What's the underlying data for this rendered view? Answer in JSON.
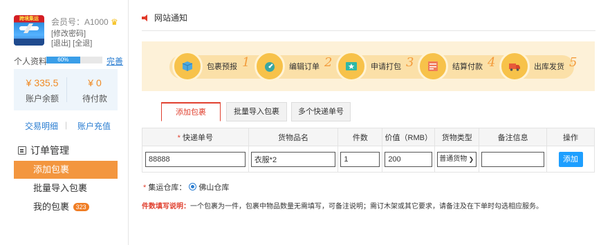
{
  "sidebar": {
    "avatar_logo_text": "跨境集运",
    "member_label": "会员号：A1000",
    "links_line1": "[修改密码]",
    "links_line2": "[退出] [全退]",
    "profile_label": "个人资料",
    "profile_progress": 0.6,
    "profile_progress_text": "60%",
    "profile_complete_link": "完善",
    "balance_value": "¥ 335.5",
    "balance_label": "账户余额",
    "pending_value": "¥ 0",
    "pending_label": "待付款",
    "transactions_link": "交易明细",
    "recharge_link": "账户充值",
    "menu_section": "订单管理",
    "menu_items": [
      {
        "label": "添加包裹",
        "active": true
      },
      {
        "label": "批量导入包裹",
        "active": false
      },
      {
        "label": "我的包裹",
        "active": false,
        "badge": "323"
      }
    ]
  },
  "notice": {
    "title": "网站通知"
  },
  "steps": [
    {
      "label": "包裹预报",
      "num": "1",
      "icon": "box-icon"
    },
    {
      "label": "编辑订单",
      "num": "2",
      "icon": "gauge-icon"
    },
    {
      "label": "申请打包",
      "num": "3",
      "icon": "star-package-icon"
    },
    {
      "label": "结算付款",
      "num": "4",
      "icon": "payment-icon"
    },
    {
      "label": "出库发货",
      "num": "5",
      "icon": "truck-icon"
    }
  ],
  "tabs": [
    {
      "label": "添加包裹",
      "active": true
    },
    {
      "label": "批量导入包裹",
      "active": false
    },
    {
      "label": "多个快递单号",
      "active": false
    }
  ],
  "table": {
    "headers": [
      "快递单号",
      "货物品名",
      "件数",
      "价值（RMB）",
      "货物类型",
      "备注信息",
      "操作"
    ],
    "required_mark": "*",
    "row": {
      "tracking": "88888",
      "item": "衣服*2",
      "qty": "1",
      "value": "200",
      "cargo_type": "普通货物",
      "remark": "",
      "action": "添加"
    }
  },
  "warehouse": {
    "required_mark": "*",
    "label": "集运仓库：",
    "option": "佛山仓库"
  },
  "note": {
    "title": "件数填写说明：",
    "text": "一个包裹为一件，包裹中物品数量无需填写，可备注说明；需订木架或其它要求，请备注及在下单时勾选相应服务。"
  },
  "colors": {
    "accent_orange": "#f3963f",
    "link_blue": "#2a7dd1",
    "button_blue": "#1e9fff",
    "required_red": "#e0402f"
  }
}
